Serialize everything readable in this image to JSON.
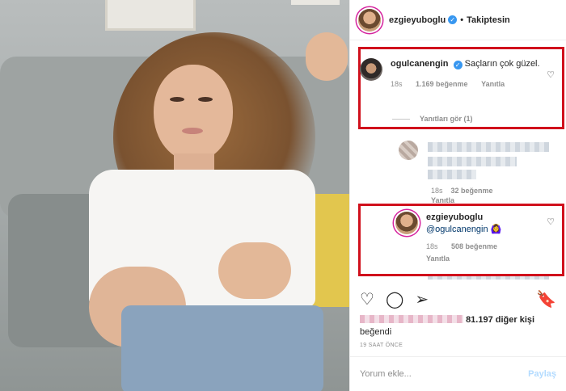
{
  "header": {
    "username": "ezgieyuboglu",
    "separator": "•",
    "follow_label": "Takiptesin"
  },
  "comments": [
    {
      "username": "ogulcanengin",
      "text": "Saçların çok güzel.",
      "time": "18s",
      "likes": "1.169 beğenme",
      "reply": "Yanıtla",
      "view_replies": "Yanıtları gör (1)"
    },
    {
      "time": "18s",
      "likes": "32 beğenme",
      "reply": "Yanıtla"
    },
    {
      "username": "ezgieyuboglu",
      "mention": "@ogulcanengin",
      "emoji": "🙆‍♀️",
      "time": "18s",
      "likes": "508 beğenme",
      "reply": "Yanıtla"
    }
  ],
  "post": {
    "likes_count": "81.197 diğer kişi",
    "likes_suffix": "beğendi",
    "time": "19 SAAT ÖNCE"
  },
  "composer": {
    "placeholder": "Yorum ekle...",
    "share": "Paylaş"
  },
  "colors": {
    "highlight_box": "#d0101c",
    "verified": "#3897f0",
    "share_disabled": "#b3dbff"
  },
  "icons": [
    "heart-icon",
    "comment-icon",
    "share-icon",
    "bookmark-icon",
    "verified-icon",
    "more-icon"
  ]
}
